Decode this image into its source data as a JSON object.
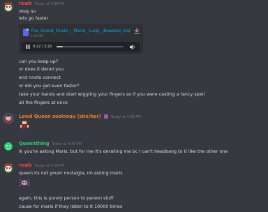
{
  "messages": [
    {
      "username": "rewb",
      "username_color": "#f04747",
      "timestamp": "Today at 4:38 PM",
      "lines_before": [
        "okay so",
        "lets go faster"
      ],
      "attachment": {
        "file_name": "The_Grand_Finale_-_Mario__Luigi__Bowsers_Insi",
        "file_size": "5.06 MB",
        "time_display": "0:12 / 2:20",
        "progress": 0.09
      },
      "lines_after": [
        "can you keep up?",
        "or does it derail you",
        "and nnoto connect",
        "or did you get even faster?",
        "take your hands and start wiggling your fingers as if you were casting a fancy spell",
        "all the fingers at once"
      ]
    },
    {
      "username": "Lewd Queen zoolooau (she/her)",
      "username_color": "#e67e22",
      "timestamp": "Today at 4:39 PM"
    },
    {
      "username": "Queenthing",
      "username_color": "#2ecc71",
      "timestamp": "Today at 4:39 PM",
      "lines": [
        "ik you're asking Maris, but for me it's derailing me bc I can't headbang to it like the other one"
      ]
    },
    {
      "username": "rewb",
      "username_color": "#f04747",
      "timestamp": "Today at 4:39 PM",
      "lines_before": [
        "queen its not youor nostalgia, im asking maris"
      ],
      "lines_after": [
        "again, this is purely person to person stuff",
        "cause for maris if they listen to it 10000 times"
      ]
    }
  ]
}
